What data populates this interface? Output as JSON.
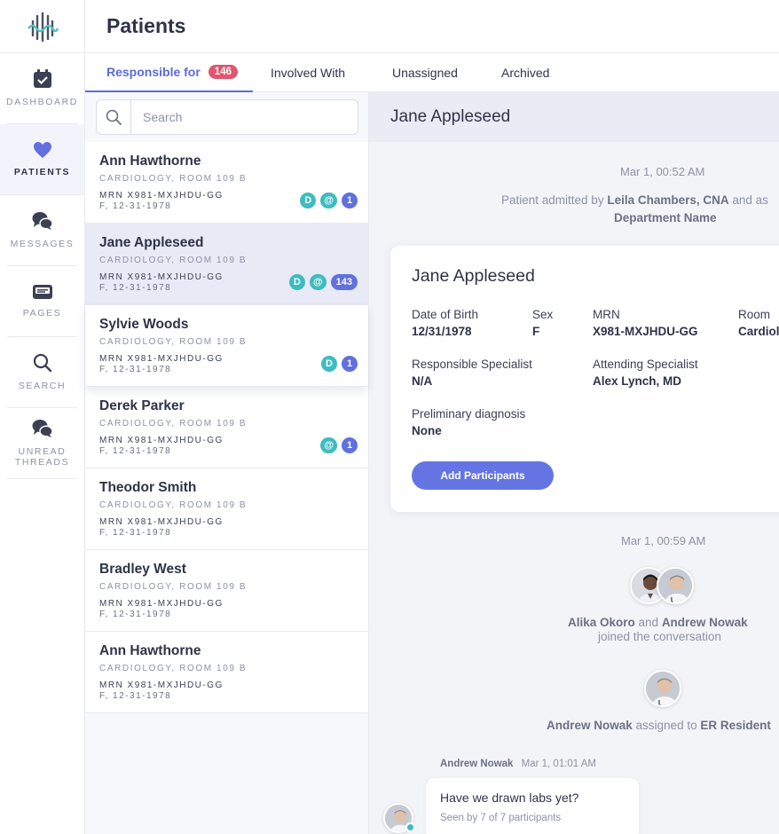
{
  "app": {
    "logo": "waveform-logo"
  },
  "nav": {
    "items": [
      {
        "label": "DASHBOARD",
        "icon": "calendar-check-icon"
      },
      {
        "label": "PATIENTS",
        "icon": "heart-icon"
      },
      {
        "label": "MESSAGES",
        "icon": "chat-bubbles-icon"
      },
      {
        "label": "PAGES",
        "icon": "pager-icon"
      },
      {
        "label": "SEARCH",
        "icon": "search-icon"
      },
      {
        "label": "UNREAD THREADS",
        "icon": "chat-bubbles-icon"
      }
    ]
  },
  "header": {
    "title": "Patients"
  },
  "tabs": [
    {
      "label": "Responsible for",
      "count": "146"
    },
    {
      "label": "Involved With"
    },
    {
      "label": "Unassigned"
    },
    {
      "label": "Archived"
    }
  ],
  "search": {
    "placeholder": "Search"
  },
  "patients": [
    {
      "name": "Ann Hawthorne",
      "location": "CARDIOLOGY, ROOM  109 B",
      "mrn": "MRN X981-MXJHDU-GG",
      "dob": "F, 12-31-1978",
      "badges": [
        "D",
        "@",
        "1"
      ]
    },
    {
      "name": "Jane Appleseed",
      "location": "CARDIOLOGY, ROOM  109 B",
      "mrn": "MRN X981-MXJHDU-GG",
      "dob": "F, 12-31-1978",
      "badges": [
        "D",
        "@",
        "143"
      ]
    },
    {
      "name": "Sylvie Woods",
      "location": "CARDIOLOGY, ROOM  109 B",
      "mrn": "MRN X981-MXJHDU-GG",
      "dob": "F, 12-31-1978",
      "badges": [
        "D",
        "1"
      ]
    },
    {
      "name": "Derek Parker",
      "location": "CARDIOLOGY, ROOM  109 B",
      "mrn": "MRN X981-MXJHDU-GG",
      "dob": "F, 12-31-1978",
      "badges": [
        "@",
        "1"
      ]
    },
    {
      "name": "Theodor Smith",
      "location": "CARDIOLOGY, ROOM  109 B",
      "mrn": "MRN X981-MXJHDU-GG",
      "dob": "F, 12-31-1978",
      "badges": []
    },
    {
      "name": "Bradley West",
      "location": "CARDIOLOGY, ROOM  109 B",
      "mrn": "MRN X981-MXJHDU-GG",
      "dob": "F, 12-31-1978",
      "badges": []
    },
    {
      "name": "Ann Hawthorne",
      "location": "CARDIOLOGY, ROOM  109 B",
      "mrn": "MRN X981-MXJHDU-GG",
      "dob": "F, 12-31-1978",
      "badges": []
    }
  ],
  "detail": {
    "title": "Jane Appleseed",
    "timeline": {
      "stamp1": "Mar 1, 00:52 AM",
      "admitted_prefix": "Patient admitted by ",
      "admitted_by": "Leila Chambers, CNA",
      "admitted_suffix": " and as",
      "department": "Department Name",
      "stamp2": "Mar 1, 00:59 AM",
      "joined_a": "Alika Okoro",
      "joined_and": " and ",
      "joined_b": "Andrew Nowak",
      "joined_suffix": "joined the conversation",
      "assigned_name": "Andrew Nowak",
      "assigned_mid": " assigned to ",
      "assigned_role": "ER Resident"
    },
    "card": {
      "name": "Jane Appleseed",
      "dob_label": "Date of Birth",
      "dob": "12/31/1978",
      "sex_label": "Sex",
      "sex": "F",
      "mrn_label": "MRN",
      "mrn": "X981-MXJHDU-GG",
      "room_label": "Room",
      "room": "Cardiol",
      "resp_label": "Responsible Specialist",
      "resp": "N/A",
      "attend_label": "Attending Specialist",
      "attend": "Alex Lynch, MD",
      "diag_label": "Preliminary diagnosis",
      "diag": "None",
      "button": "Add Participants"
    },
    "message": {
      "author": "Andrew Nowak",
      "time": "Mar 1, 01:01 AM",
      "text": "Have we drawn labs yet?",
      "seen": "Seen by 7 of 7 participants"
    }
  },
  "colors": {
    "accent": "#5c6bd9",
    "badge_red": "#e0566f",
    "teal": "#3fbcbf",
    "indigo": "#6070dd"
  }
}
